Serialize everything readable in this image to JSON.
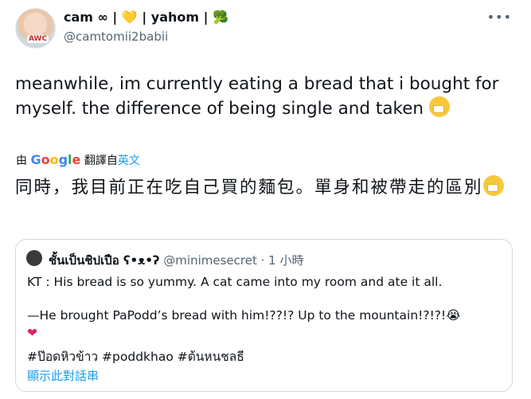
{
  "author": {
    "name": "cam ∞ |",
    "heart": "💛",
    "name_mid": "| yahom |",
    "broccoli": "🥦",
    "handle": "@camtomii2babii",
    "avatar_badge": "AWC"
  },
  "more_icon": "•••",
  "tweet": {
    "text": "meanwhile, im currently eating a bread that i bought for myself. the difference of being single and taken "
  },
  "translate": {
    "prefix": "由",
    "google": [
      "G",
      "o",
      "o",
      "g",
      "l",
      "e"
    ],
    "suffix": "翻譯自",
    "language": "英文"
  },
  "translated_text": "同時，我目前正在吃自己買的麵包。單身和被帶走的區別",
  "quote": {
    "name": "ชั้นเป็นชิปเปือ ʕ•ᴥ•ʔ",
    "handle": "@minimesecret",
    "time": " · 1 小時",
    "line1": "KT : His bread is so yummy. A cat came into my room and ate it all.",
    "line2": "—He brought PaPodd’s bread with him!??!? Up to the mountain!?!?!😭",
    "heart": "❤",
    "hashtags": "#ป๊อดหิวข้าว #poddkhao #ต้นหนชลธี",
    "show_thread": "顯示此對話串"
  }
}
